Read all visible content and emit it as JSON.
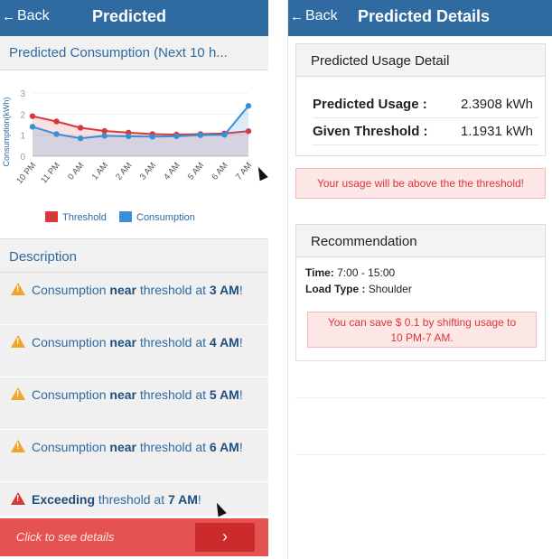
{
  "left": {
    "nav": {
      "back_label": "Back",
      "title": "Predicted"
    },
    "card_title": "Predicted Consumption (Next 10 h...",
    "description_title": "Description",
    "descriptions": [
      {
        "pre": "Consumption ",
        "bold": "near",
        "post": " threshold at ",
        "time": "3 AM",
        "tail": "!",
        "level": "warning"
      },
      {
        "pre": "Consumption ",
        "bold": "near",
        "post": " threshold at ",
        "time": "4 AM",
        "tail": "!",
        "level": "warning"
      },
      {
        "pre": "Consumption ",
        "bold": "near",
        "post": " threshold at ",
        "time": "5 AM",
        "tail": "!",
        "level": "warning"
      },
      {
        "pre": "Consumption ",
        "bold": "near",
        "post": " threshold at ",
        "time": "6 AM",
        "tail": "!",
        "level": "warning"
      },
      {
        "pre": "",
        "bold": "Exceeding",
        "post": " threshold at ",
        "time": "7 AM",
        "tail": "!",
        "level": "danger"
      }
    ],
    "cta_label": "Click to see details",
    "cta_button": "›"
  },
  "right": {
    "nav": {
      "back_label": "Back",
      "title": "Predicted Details"
    },
    "usage_panel_title": "Predicted Usage Detail",
    "predicted_usage_label": "Predicted Usage :",
    "predicted_usage_value": "2.3908 kWh",
    "threshold_label": "Given Threshold :",
    "threshold_value": "1.1931 kWh",
    "alert": "Your usage will be above the the threshold!",
    "reco_title": "Recommendation",
    "time_label": "Time:",
    "time_value": " 7:00 - 15:00",
    "load_label": "Load Type :",
    "load_value": " Shoulder",
    "save_line1": "You can save $ 0.1 by shifting usage to",
    "save_line2": "10 PM-7 AM."
  },
  "colors": {
    "navbar": "#2f6aa0",
    "threshold": "#d9383a",
    "consumption": "#3a8fd6",
    "cta": "#e45252",
    "warning": "#f0a42a"
  },
  "chart_data": {
    "type": "line",
    "categories": [
      "10 PM",
      "11 PM",
      "0 AM",
      "1 AM",
      "2 AM",
      "3 AM",
      "4 AM",
      "5 AM",
      "6 AM",
      "7 AM"
    ],
    "series": [
      {
        "name": "Threshold",
        "values": [
          1.9,
          1.65,
          1.35,
          1.2,
          1.12,
          1.05,
          1.03,
          1.05,
          1.08,
          1.19
        ]
      },
      {
        "name": "Consumption",
        "values": [
          1.4,
          1.05,
          0.85,
          0.97,
          0.95,
          0.93,
          0.95,
          1.0,
          1.02,
          2.39
        ]
      }
    ],
    "ylabel": "Consumption(kWh)",
    "xlabel": "",
    "yticks": [
      0,
      1,
      2,
      3
    ],
    "ylim": [
      0,
      3
    ],
    "legend_position": "bottom",
    "area_fill": true
  }
}
